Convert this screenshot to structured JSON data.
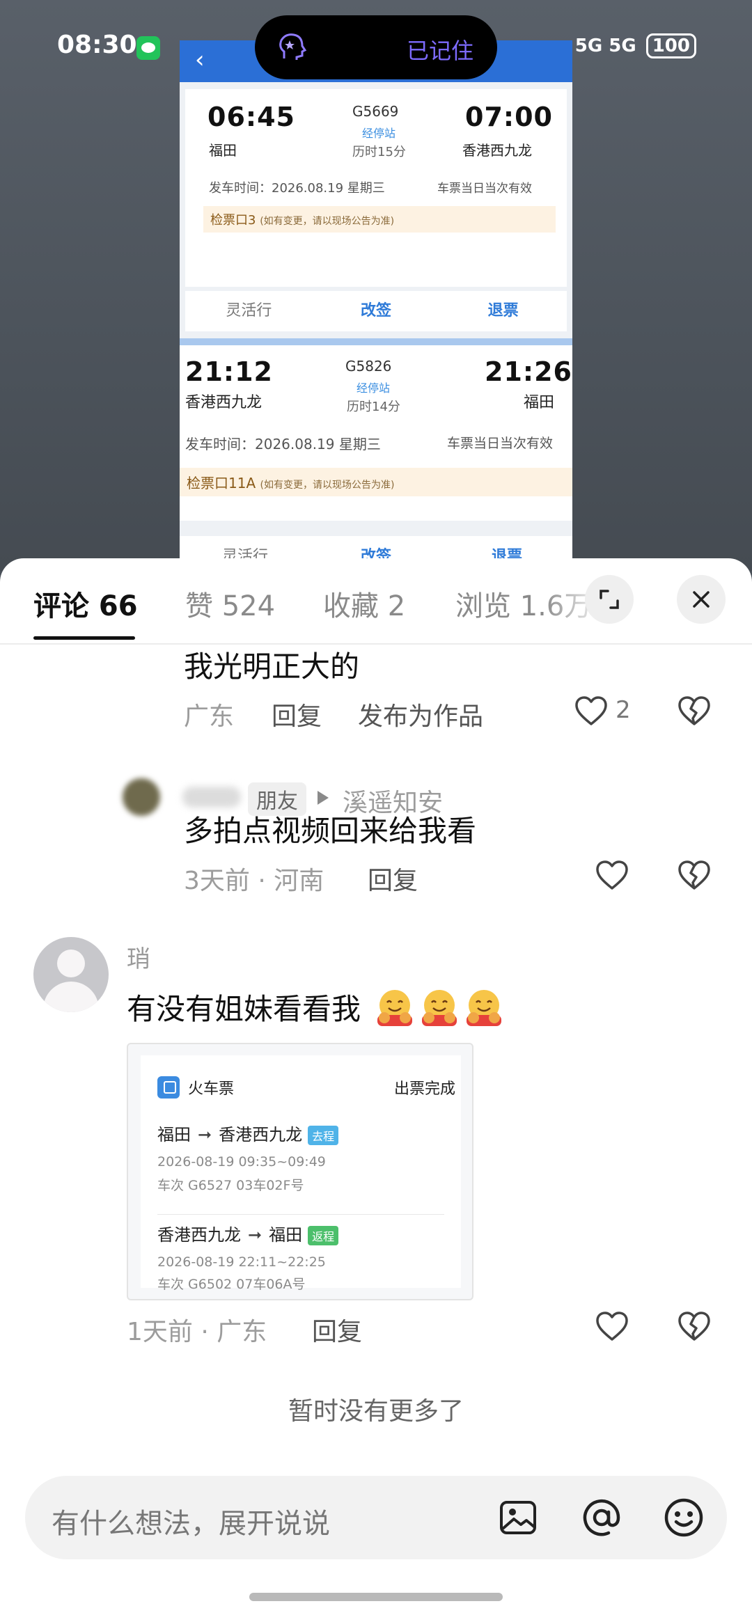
{
  "status_bar": {
    "time": "08:30",
    "network": "5G 5G",
    "battery": "100"
  },
  "pill": {
    "label": "已记住"
  },
  "ticket_screenshot": {
    "trip1": {
      "dep_time": "06:45",
      "dep_station": "福田",
      "train": "G5669",
      "stop_link": "经停站",
      "duration": "历时15分",
      "arr_time": "07:00",
      "arr_station": "香港西九龙",
      "dep_date": "发车时间：2026.08.19 星期三",
      "validity": "车票当日当次有效",
      "gate": "检票口3",
      "gate_note": "(如有变更，请以现场公告为准)"
    },
    "trip2": {
      "dep_time": "21:12",
      "dep_station": "香港西九龙",
      "train": "G5826",
      "stop_link": "经停站",
      "duration": "历时14分",
      "arr_time": "21:26",
      "arr_station": "福田",
      "dep_date": "发车时间：2026.08.19 星期三",
      "validity": "车票当日当次有效",
      "gate": "检票口11A",
      "gate_note": "(如有变更，请以现场公告为准)"
    },
    "actions": [
      "灵活行",
      "改签",
      "退票"
    ]
  },
  "tabs": [
    {
      "label": "评论 66",
      "active": true
    },
    {
      "label": "赞 524",
      "active": false
    },
    {
      "label": "收藏 2",
      "active": false
    },
    {
      "label": "浏览 1.6万",
      "active": false
    }
  ],
  "comments": [
    {
      "text": "我光明正大的",
      "meta": "广东",
      "reply": "回复",
      "extra": "发布为作品",
      "likes": "2"
    },
    {
      "friend_tag": "朋友",
      "reply_to": "溪遥知安",
      "text": "多拍点视频回来给我看",
      "meta": "3天前 · 河南",
      "reply": "回复"
    },
    {
      "username": "琑",
      "text": "有没有姐妹看看我",
      "meta": "1天前 · 广东",
      "reply": "回复",
      "card": {
        "title": "火车票",
        "status": "出票完成",
        "outbound": {
          "from": "福田",
          "to": "香港西九龙",
          "tag": "去程",
          "time": "2026-08-19 09:35~09:49",
          "train": "车次 G6527 03车02F号"
        },
        "return": {
          "from": "香港西九龙",
          "to": "福田",
          "tag": "返程",
          "time": "2026-08-19 22:11~22:25",
          "train": "车次 G6502 07车06A号"
        }
      }
    }
  ],
  "no_more": "暂时没有更多了",
  "input": {
    "placeholder": "有什么想法，展开说说"
  },
  "colors": {
    "accent_blue": "#2f7bd8",
    "outbound_tag": "#4fb3e8",
    "return_tag": "#4cbf6b",
    "pill_text": "#7d6bff"
  }
}
